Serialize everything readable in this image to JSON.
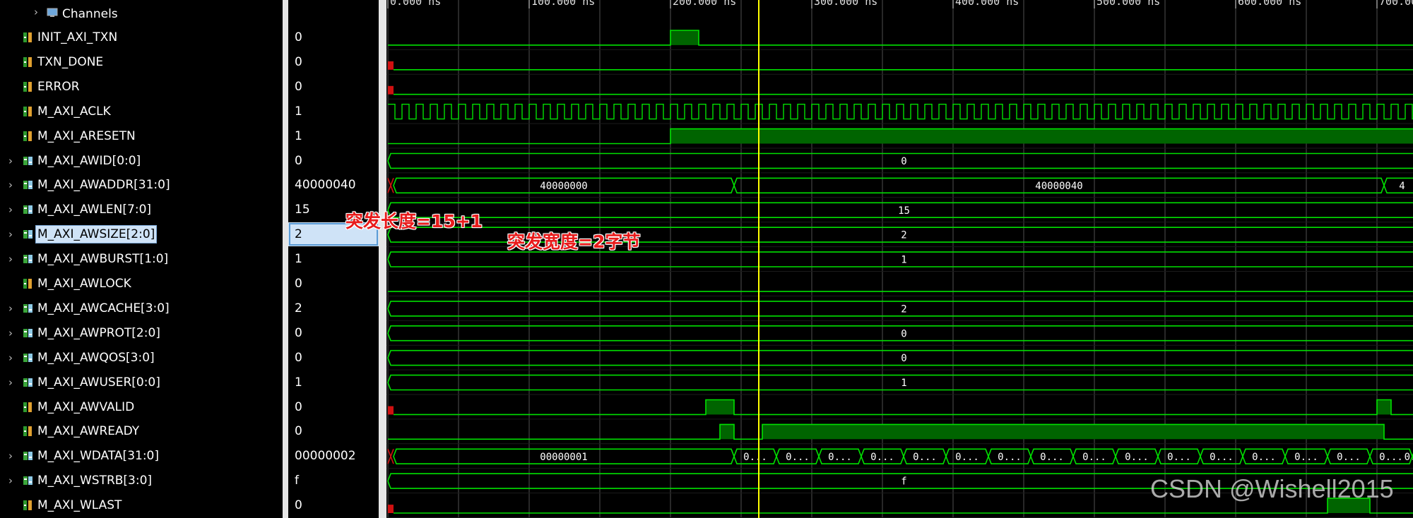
{
  "group_label": "Channels",
  "signals": [
    {
      "name": "INIT_AXI_TXN",
      "value": "0",
      "bus": false
    },
    {
      "name": "TXN_DONE",
      "value": "0",
      "bus": false
    },
    {
      "name": "ERROR",
      "value": "0",
      "bus": false
    },
    {
      "name": "M_AXI_ACLK",
      "value": "1",
      "bus": false
    },
    {
      "name": "M_AXI_ARESETN",
      "value": "1",
      "bus": false
    },
    {
      "name": "M_AXI_AWID[0:0]",
      "value": "0",
      "bus": true
    },
    {
      "name": "M_AXI_AWADDR[31:0]",
      "value": "40000040",
      "bus": true
    },
    {
      "name": "M_AXI_AWLEN[7:0]",
      "value": "15",
      "bus": true
    },
    {
      "name": "M_AXI_AWSIZE[2:0]",
      "value": "2",
      "bus": true,
      "selected": true
    },
    {
      "name": "M_AXI_AWBURST[1:0]",
      "value": "1",
      "bus": true
    },
    {
      "name": "M_AXI_AWLOCK",
      "value": "0",
      "bus": false
    },
    {
      "name": "M_AXI_AWCACHE[3:0]",
      "value": "2",
      "bus": true
    },
    {
      "name": "M_AXI_AWPROT[2:0]",
      "value": "0",
      "bus": true
    },
    {
      "name": "M_AXI_AWQOS[3:0]",
      "value": "0",
      "bus": true
    },
    {
      "name": "M_AXI_AWUSER[0:0]",
      "value": "1",
      "bus": true
    },
    {
      "name": "M_AXI_AWVALID",
      "value": "0",
      "bus": false
    },
    {
      "name": "M_AXI_AWREADY",
      "value": "0",
      "bus": false
    },
    {
      "name": "M_AXI_WDATA[31:0]",
      "value": "00000002",
      "bus": true
    },
    {
      "name": "M_AXI_WSTRB[3:0]",
      "value": "f",
      "bus": true
    },
    {
      "name": "M_AXI_WLAST",
      "value": "0",
      "bus": false
    }
  ],
  "time_ticks": [
    "0.000 ns",
    "100.000 ns",
    "200.000 ns",
    "300.000 ns",
    "400.000 ns",
    "500.000 ns",
    "600.000 ns",
    "700.000 ns"
  ],
  "bus_labels": {
    "awid": "0",
    "awaddr_1": "40000000",
    "awaddr_2": "40000040",
    "awaddr_3": "4",
    "awlen": "15",
    "awsize": "2",
    "awburst": "1",
    "awcache": "2",
    "awprot": "0",
    "awqos": "0",
    "awuser": "1",
    "wdata_1": "00000001",
    "wdata_short": "0...",
    "wstrb": "f"
  },
  "annotations": {
    "burst_length": "突发长度=15+1",
    "burst_width": "突发宽度=2字节"
  },
  "watermark": "CSDN @Wishell2015",
  "colors": {
    "wave": "#00e000",
    "wave_fill": "#006400",
    "cursor": "#ffff00",
    "grid": "#3a3a3a",
    "annotation": "#e81b1b"
  }
}
